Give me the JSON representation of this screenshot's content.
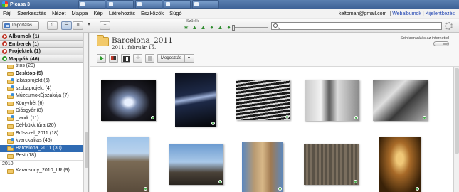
{
  "window": {
    "title": "Picasa 3"
  },
  "taskbar": {
    "tabs": [
      "",
      "",
      "",
      "",
      ""
    ]
  },
  "menu": {
    "items": [
      "Fájl",
      "Szerkesztés",
      "Nézet",
      "Mappa",
      "Kép",
      "Létrehozás",
      "Eszközök",
      "Súgó"
    ],
    "account_email": "keltoman@gmail.com",
    "webalbums_link": "Webalbumok",
    "logout_link": "Kijelentkezés"
  },
  "toolbar": {
    "import_label": "Importálás",
    "filter_label": "Szűrők",
    "search_value": "",
    "search_placeholder": ""
  },
  "sidebar": {
    "sections": [
      {
        "label": "Albumok (1)",
        "open": false
      },
      {
        "label": "Emberek (1)",
        "open": false
      },
      {
        "label": "Projektek (1)",
        "open": false
      },
      {
        "label": "Mappák (46)",
        "open": true
      }
    ],
    "folders": [
      {
        "label": "titos (20)",
        "bold": false,
        "shared": false
      },
      {
        "label": "Desktop (5)",
        "bold": true,
        "shared": false
      },
      {
        "label": "lakásprojekt (5)",
        "bold": false,
        "shared": true
      },
      {
        "label": "szobaprojekt (4)",
        "bold": false,
        "shared": true
      },
      {
        "label": "MúzeumokÉjszakája (7)",
        "bold": false,
        "shared": true
      },
      {
        "label": "Könyvhét (6)",
        "bold": false,
        "shared": false
      },
      {
        "label": "Diósgyőr (8)",
        "bold": false,
        "shared": false
      },
      {
        "label": "_work (11)",
        "bold": false,
        "shared": true
      },
      {
        "label": "Dél-bükk túra (20)",
        "bold": false,
        "shared": false
      },
      {
        "label": "Brüsszel_2011 (18)",
        "bold": false,
        "shared": false
      },
      {
        "label": "kvarckalitas (45)",
        "bold": false,
        "shared": true
      },
      {
        "label": "Barcelona_2011 (30)",
        "bold": false,
        "shared": true,
        "selected": true
      },
      {
        "label": "Pest (18)",
        "bold": false,
        "shared": false
      }
    ],
    "year": "2010",
    "year_folder": "Karacsony_2010_LR (9)"
  },
  "album": {
    "title": "Barcelona_2011",
    "date": "2011. február 15.",
    "sync_label": "Szinkronizálás az internettel",
    "share_label": "Megosztás"
  },
  "photos": [
    {
      "name": "photo-fountain-night"
    },
    {
      "name": "photo-light-beams"
    },
    {
      "name": "photo-memorial-text"
    },
    {
      "name": "photo-monument-bw"
    },
    {
      "name": "photo-metro-sign"
    },
    {
      "name": "photo-sagrada-facade"
    },
    {
      "name": "photo-sagrada-cranes"
    },
    {
      "name": "photo-tower-detail"
    },
    {
      "name": "photo-stone-relief"
    },
    {
      "name": "photo-church-interior"
    }
  ],
  "colors": {
    "selection": "#2f6bb3",
    "accent_green": "#2e9a2e",
    "folder": "#f0c868"
  }
}
